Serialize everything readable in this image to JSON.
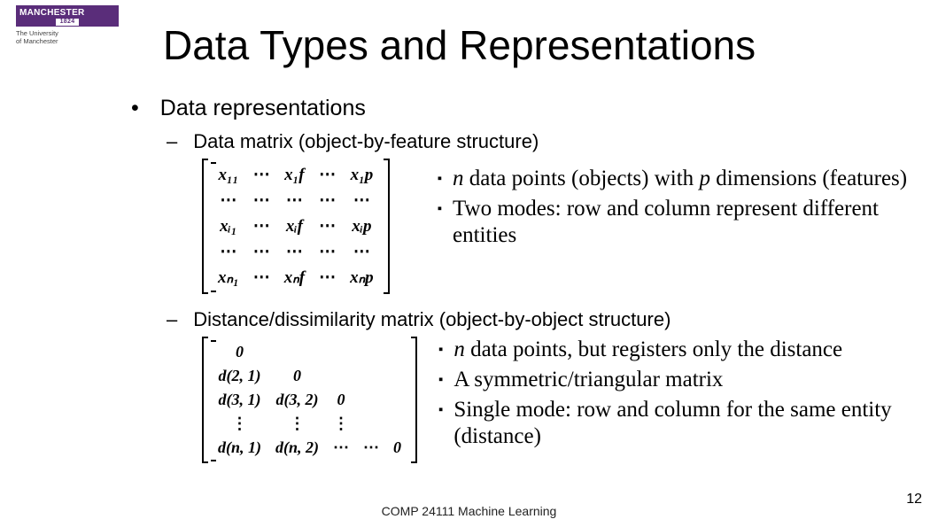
{
  "logo": {
    "brand": "MANCHESTER",
    "year": "1824",
    "sub1": "The University",
    "sub2": "of Manchester"
  },
  "title": "Data Types and Representations",
  "main_bullet": "Data representations",
  "sub1": "Data matrix (object-by-feature structure)",
  "matrix1": {
    "r1": [
      "x₁₁",
      "⋯",
      "x₁f",
      "⋯",
      "x₁p"
    ],
    "r2": [
      "⋯",
      "⋯",
      "⋯",
      "⋯",
      "⋯"
    ],
    "r3": [
      "xᵢ₁",
      "⋯",
      "xᵢf",
      "⋯",
      "xᵢp"
    ],
    "r4": [
      "⋯",
      "⋯",
      "⋯",
      "⋯",
      "⋯"
    ],
    "r5": [
      "xₙ₁",
      "⋯",
      "xₙf",
      "⋯",
      "xₙp"
    ]
  },
  "notes1": {
    "a_pre": "n",
    "a_mid": " data points (objects) with ",
    "a_post": "p",
    "a_end": " dimensions (features)",
    "b": "Two modes: row and column represent different entities"
  },
  "sub2": "Distance/dissimilarity matrix (object-by-object structure)",
  "matrix2": {
    "r1": [
      "0",
      "",
      "",
      "",
      ""
    ],
    "r2": [
      "d(2, 1)",
      "0",
      "",
      "",
      ""
    ],
    "r3": [
      "d(3, 1)",
      "d(3, 2)",
      "0",
      "",
      ""
    ],
    "r4": [
      "⋮",
      "⋮",
      "⋮",
      "",
      ""
    ],
    "r5": [
      "d(n, 1)",
      "d(n, 2)",
      "⋯",
      "⋯",
      "0"
    ]
  },
  "notes2": {
    "a_pre": "n",
    "a_rest": " data points, but registers only the distance",
    "b": "A symmetric/triangular matrix",
    "c": "Single mode: row and column for the same entity (distance)"
  },
  "footer": "COMP 24111  Machine Learning",
  "page": "12"
}
